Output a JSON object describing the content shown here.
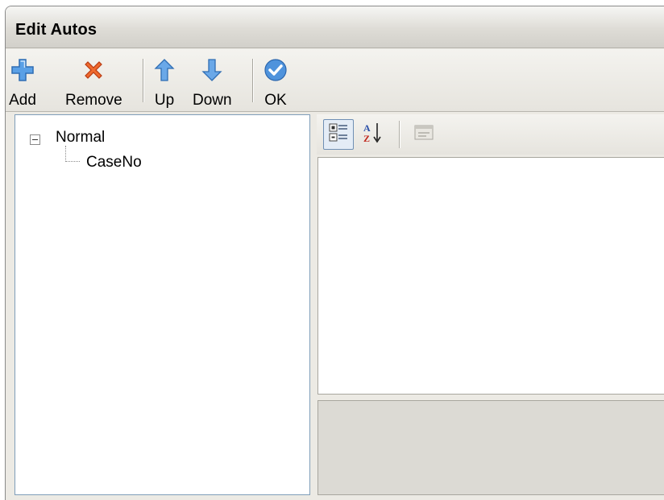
{
  "window": {
    "title": "Edit Autos"
  },
  "toolbar": {
    "buttons": [
      {
        "label": "Add",
        "icon": "add-icon",
        "color": "#4a8fd8"
      },
      {
        "label": "Remove",
        "icon": "remove-icon",
        "color": "#e8501e"
      },
      {
        "label": "Up",
        "icon": "up-arrow-icon",
        "color": "#4a8fd8"
      },
      {
        "label": "Down",
        "icon": "down-arrow-icon",
        "color": "#4a8fd8"
      },
      {
        "label": "OK",
        "icon": "check-icon",
        "color": "#3a7fd0"
      }
    ]
  },
  "tree": {
    "nodes": [
      {
        "label": "Normal",
        "expanded": true,
        "children": [
          {
            "label": "CaseNo"
          }
        ]
      }
    ]
  },
  "property_grid": {
    "toolbar": [
      "categorized-icon",
      "alphabetical-sort-icon",
      "property-pages-icon"
    ]
  }
}
